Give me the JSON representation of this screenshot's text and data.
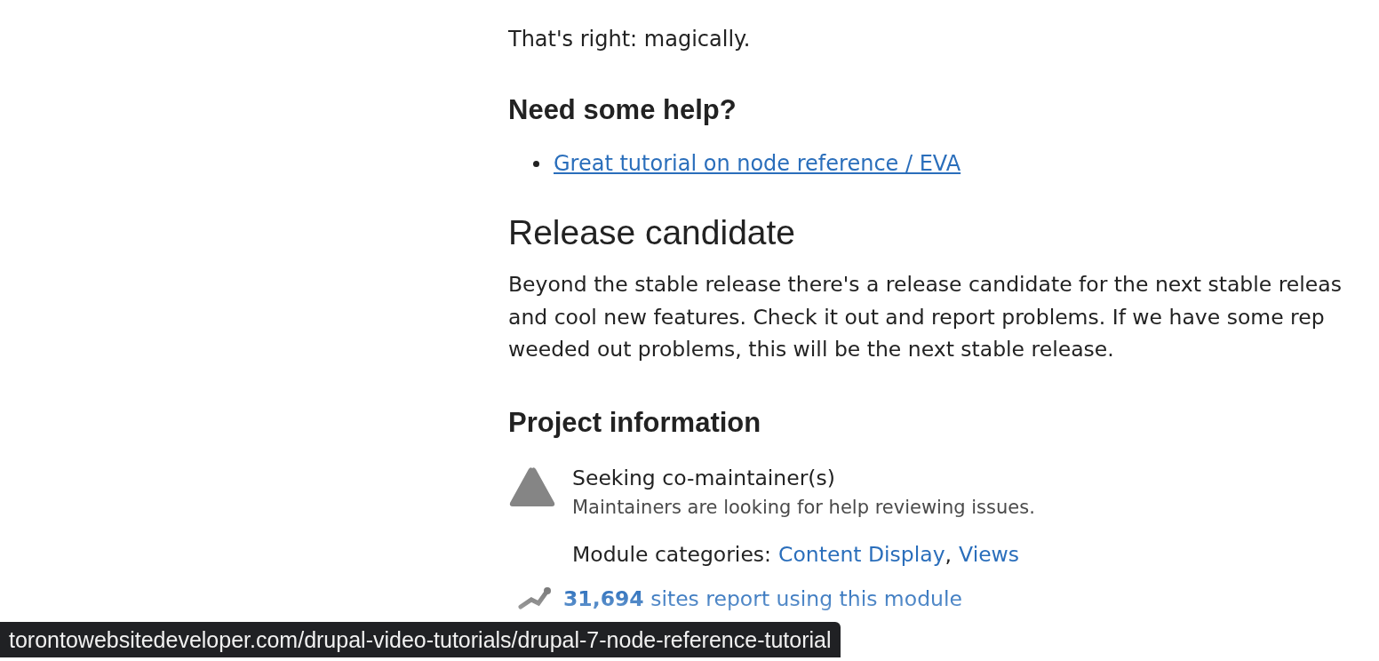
{
  "intro": "That's right: magically.",
  "help": {
    "heading": "Need some help?",
    "links": [
      "Great tutorial on node reference / EVA"
    ]
  },
  "release": {
    "heading": "Release candidate",
    "lines": [
      "Beyond the stable release there's a release candidate for the next stable releas",
      "and cool new features. Check it out and report problems. If we have some rep",
      "weeded out problems, this will be the next stable release."
    ]
  },
  "project": {
    "heading": "Project information",
    "status": {
      "title": "Seeking co-maintainer(s)",
      "description": "Maintainers are looking for help reviewing issues."
    },
    "categories": {
      "label": "Module categories:",
      "links": [
        "Content Display",
        "Views"
      ],
      "separator": ","
    },
    "usage": {
      "count": "31,694",
      "text": "sites report using this module"
    }
  },
  "status_bar": {
    "url": "torontowebsitedeveloper.com/drupal-video-tutorials/drupal-7-node-reference-tutorial"
  }
}
